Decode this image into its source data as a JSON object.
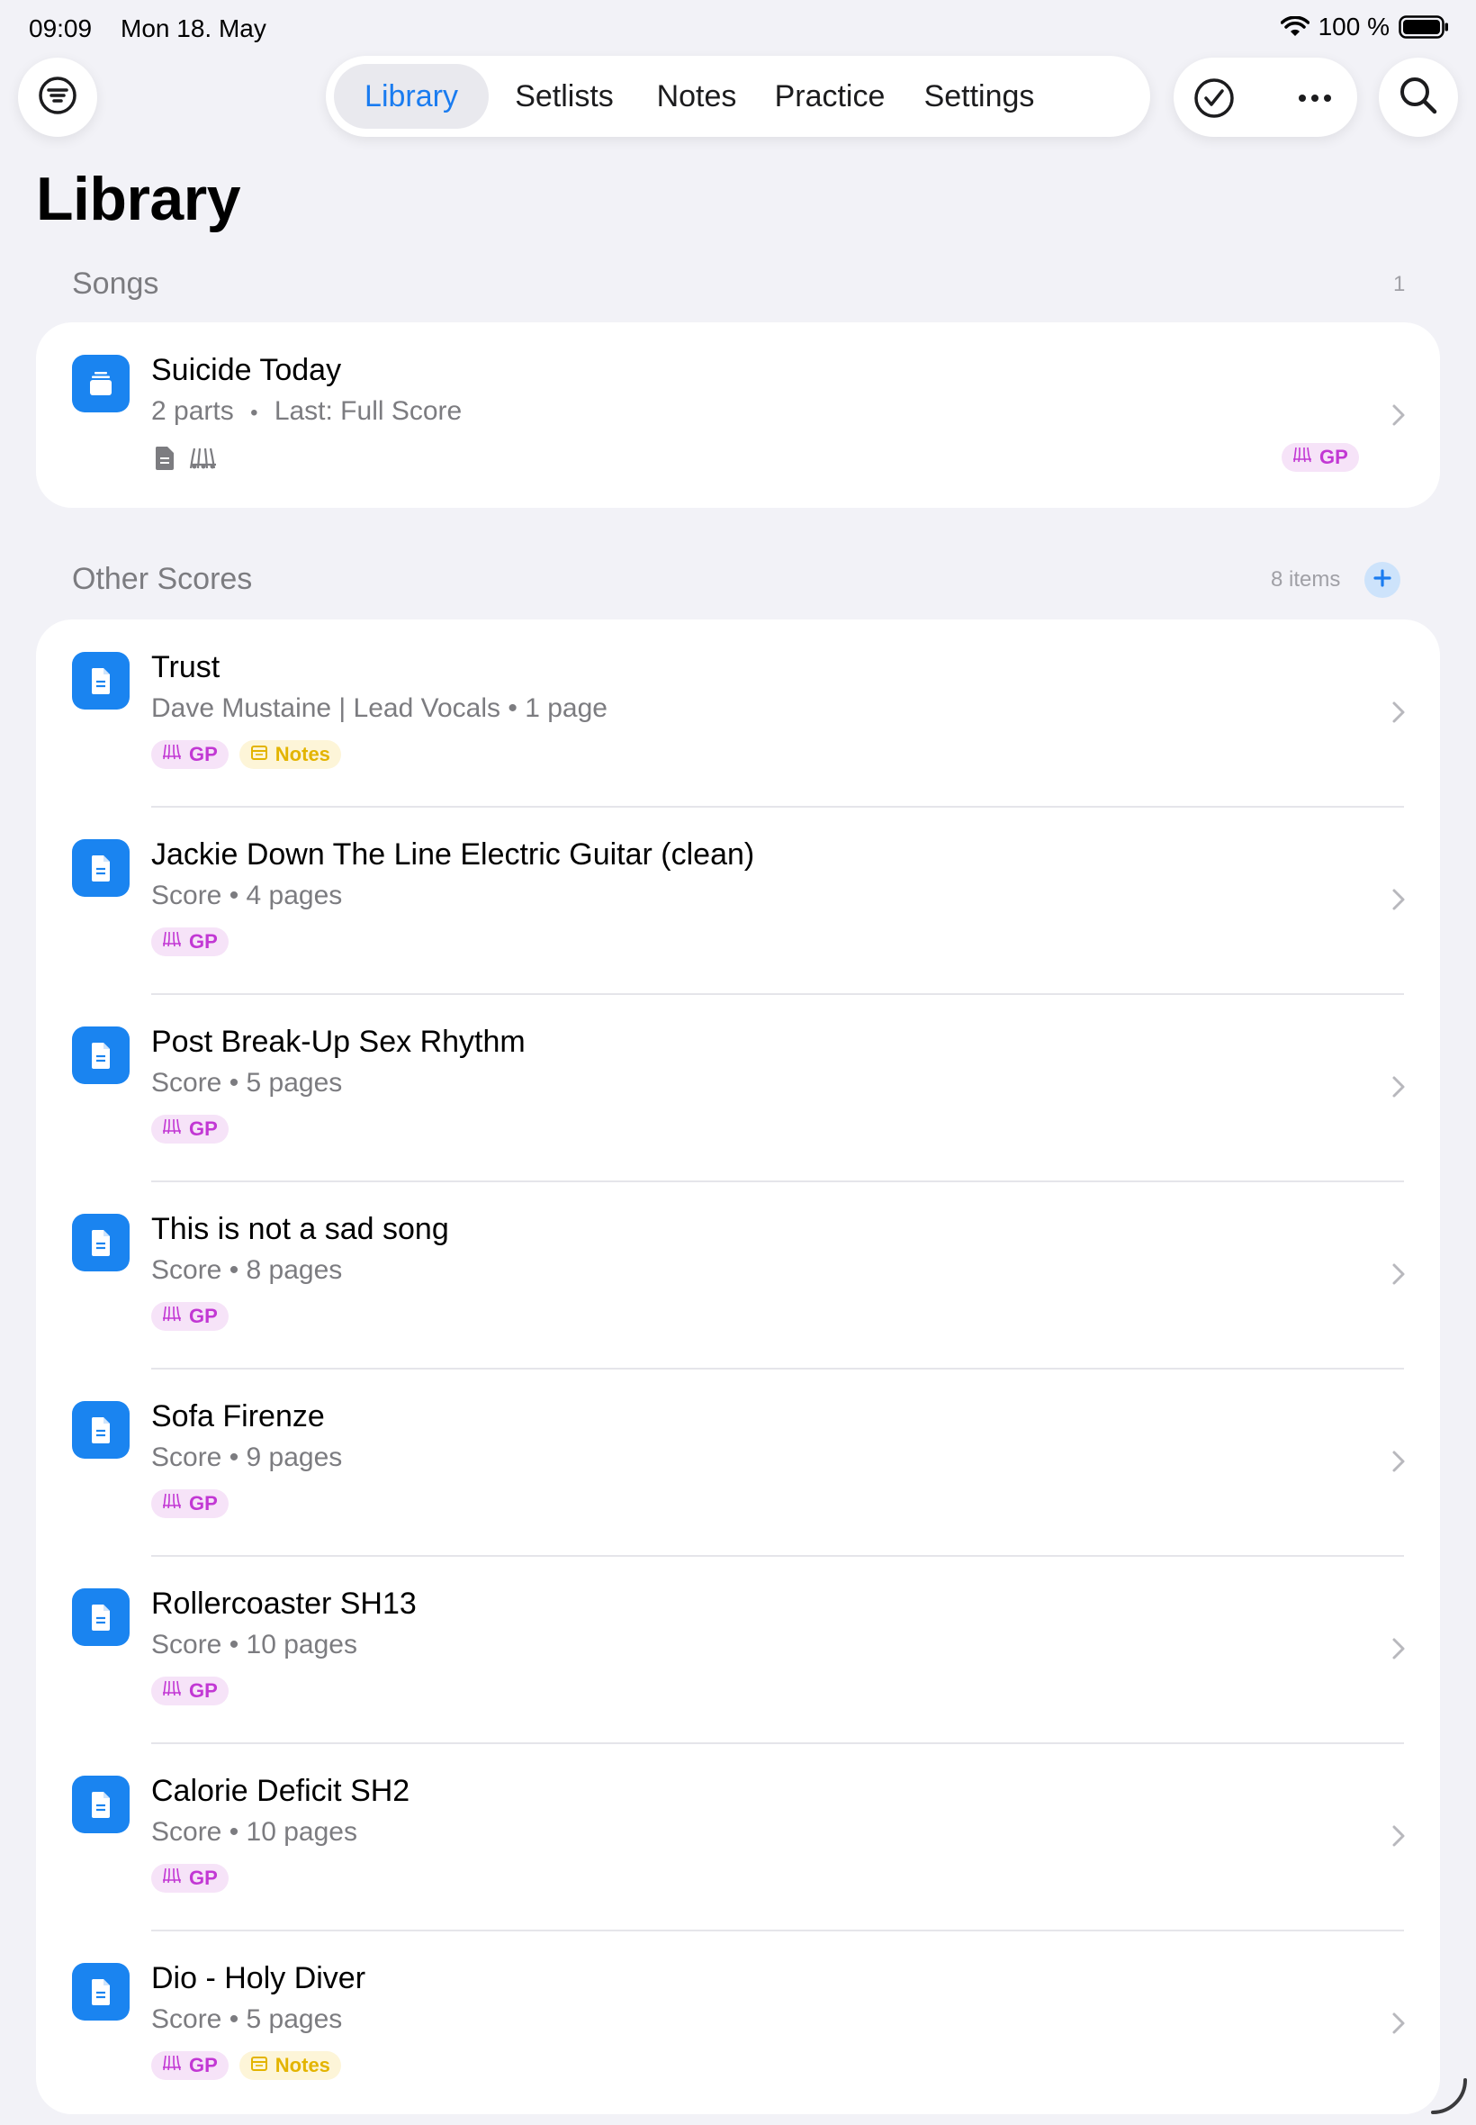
{
  "status": {
    "time": "09:09",
    "date": "Mon 18. May",
    "battery": "100 %"
  },
  "tabs": [
    {
      "label": "Library",
      "active": true
    },
    {
      "label": "Setlists",
      "active": false
    },
    {
      "label": "Notes",
      "active": false
    },
    {
      "label": "Practice",
      "active": false
    },
    {
      "label": "Settings",
      "active": false
    }
  ],
  "icons": {
    "filter": "filter-circle-icon",
    "check": "checkmark-circle-icon",
    "more": "ellipsis-icon",
    "search": "magnifying-glass-icon"
  },
  "page_title": "Library",
  "songs_section": {
    "header": "Songs",
    "count": "1",
    "song": {
      "title": "Suicide Today",
      "parts": "2 parts",
      "dot": "•",
      "last": "Last: Full Score",
      "badge": "GP"
    }
  },
  "scores_section": {
    "header": "Other Scores",
    "count": "8 items",
    "items": [
      {
        "title": "Trust",
        "subtitle": "Dave Mustaine | Lead Vocals • 1 page",
        "gp": "GP",
        "notes": "Notes"
      },
      {
        "title": "Jackie Down The Line Electric Guitar (clean)",
        "subtitle": "Score • 4 pages",
        "gp": "GP"
      },
      {
        "title": "Post Break-Up Sex Rhythm",
        "subtitle": "Score • 5 pages",
        "gp": "GP"
      },
      {
        "title": "This is not a sad song",
        "subtitle": "Score • 8 pages",
        "gp": "GP"
      },
      {
        "title": "Sofa Firenze",
        "subtitle": "Score • 9 pages",
        "gp": "GP"
      },
      {
        "title": "Rollercoaster SH13",
        "subtitle": "Score • 10 pages",
        "gp": "GP"
      },
      {
        "title": "Calorie Deficit SH2",
        "subtitle": "Score • 10 pages",
        "gp": "GP"
      },
      {
        "title": "Dio - Holy Diver",
        "subtitle": "Score • 5 pages",
        "gp": "GP",
        "notes": "Notes"
      }
    ]
  },
  "colors": {
    "accent": "#1a7cf0",
    "background": "#f2f2f7",
    "gp_badge": "#c238d4",
    "notes_badge": "#e3b400"
  }
}
